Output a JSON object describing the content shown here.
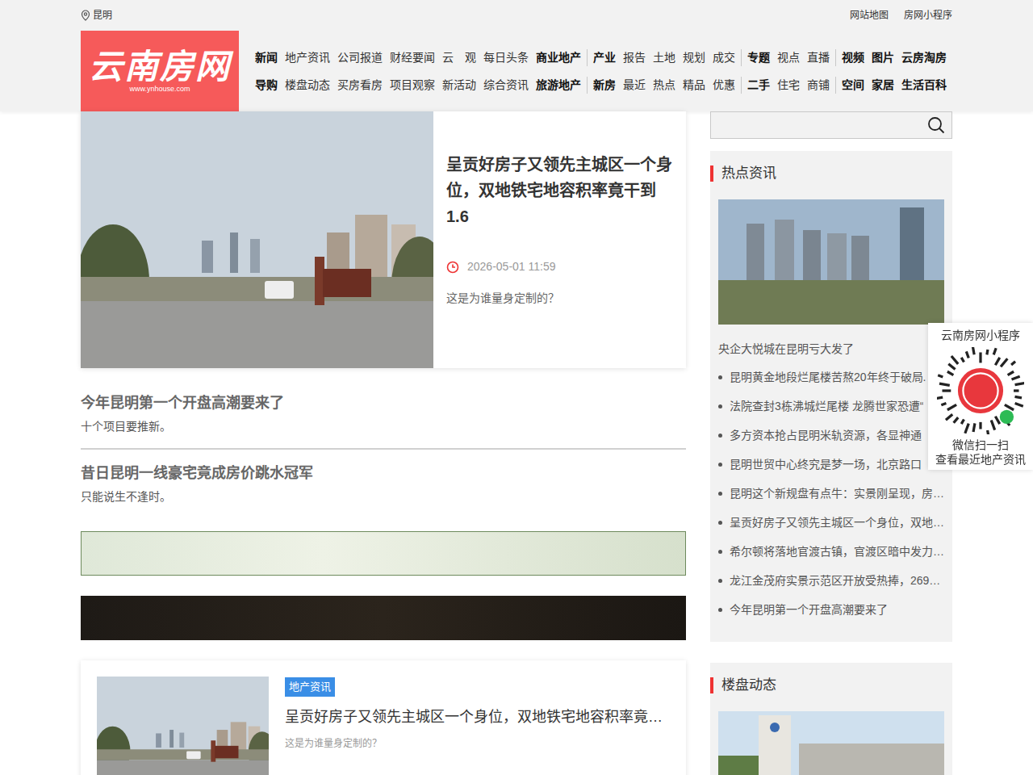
{
  "header": {
    "location": "昆明",
    "links": [
      "网站地图",
      "房网小程序"
    ]
  },
  "logo": {
    "title": "云南房网",
    "url": "www.ynhouse.com"
  },
  "nav": {
    "rows": [
      [
        [
          {
            "label": "新闻",
            "bold": true
          },
          {
            "label": "地产资讯",
            "bold": false
          },
          {
            "label": "公司报道",
            "bold": false
          },
          {
            "label": "财经要闻",
            "bold": false
          },
          {
            "label": "云　观",
            "bold": false
          },
          {
            "label": "每日头条",
            "bold": false
          },
          {
            "label": "商业地产",
            "bold": true
          }
        ],
        [
          {
            "label": "产业",
            "bold": true
          },
          {
            "label": "报告",
            "bold": false
          },
          {
            "label": "土地",
            "bold": false
          },
          {
            "label": "规划",
            "bold": false
          },
          {
            "label": "成交",
            "bold": false
          }
        ],
        [
          {
            "label": "专题",
            "bold": true
          },
          {
            "label": "视点",
            "bold": false
          },
          {
            "label": "直播",
            "bold": false
          }
        ],
        [
          {
            "label": "视频",
            "bold": true
          },
          {
            "label": "图片",
            "bold": true
          },
          {
            "label": "云房淘房",
            "bold": true
          }
        ]
      ],
      [
        [
          {
            "label": "导购",
            "bold": true
          },
          {
            "label": "楼盘动态",
            "bold": false
          },
          {
            "label": "买房看房",
            "bold": false
          },
          {
            "label": "项目观察",
            "bold": false
          },
          {
            "label": "新活动",
            "bold": false
          },
          {
            "label": "综合资讯",
            "bold": false
          },
          {
            "label": "旅游地产",
            "bold": true
          }
        ],
        [
          {
            "label": "新房",
            "bold": true
          },
          {
            "label": "最近",
            "bold": false
          },
          {
            "label": "热点",
            "bold": false
          },
          {
            "label": "精品",
            "bold": false
          },
          {
            "label": "优惠",
            "bold": false
          }
        ],
        [
          {
            "label": "二手",
            "bold": true
          },
          {
            "label": "住宅",
            "bold": false
          },
          {
            "label": "商铺",
            "bold": false
          }
        ],
        [
          {
            "label": "空间",
            "bold": true
          },
          {
            "label": "家居",
            "bold": true
          },
          {
            "label": "生活百科",
            "bold": true
          }
        ]
      ]
    ]
  },
  "featured": {
    "title": "呈贡好房子又领先主城区一个身位，双地铁宅地容积率竟干到1.6",
    "time": "2026-05-01 11:59",
    "summary": "这是为谁量身定制的？"
  },
  "text_items": [
    {
      "title": "今年昆明第一个开盘高潮要来了",
      "summary": "十个项目要推新。"
    },
    {
      "title": "昔日昆明一线豪宅竟成房价跳水冠军",
      "summary": "只能说生不逢时。"
    }
  ],
  "article_card": {
    "tag": "地产资讯",
    "title": "呈贡好房子又领先主城区一个身位，双地铁宅地容积率竟…",
    "summary": "这是为谁量身定制的？"
  },
  "hot": {
    "title": "热点资讯",
    "caption": "央企大悦城在昆明亏大发了",
    "items": [
      "昆明黄金地段烂尾楼苦熬20年终于破局.",
      "法院查封3栋沸城烂尾楼 龙腾世家恐遭“",
      "多方资本抢占昆明米轨资源，各显神通",
      "昆明世贸中心终究是梦一场，北京路口",
      "昆明这个新规盘有点牛：实景刚呈现，房…",
      "呈贡好房子又领先主城区一个身位，双地…",
      "希尔顿将落地官渡古镇，官渡区暗中发力…",
      "龙江金茂府实景示范区开放受热捧，269…",
      "今年昆明第一个开盘高潮要来了"
    ]
  },
  "loupan": {
    "title": "楼盘动态"
  },
  "miniprogram": {
    "title": "云南房网小程序",
    "lines": [
      "微信扫一扫",
      "查看最近地产资讯"
    ]
  }
}
